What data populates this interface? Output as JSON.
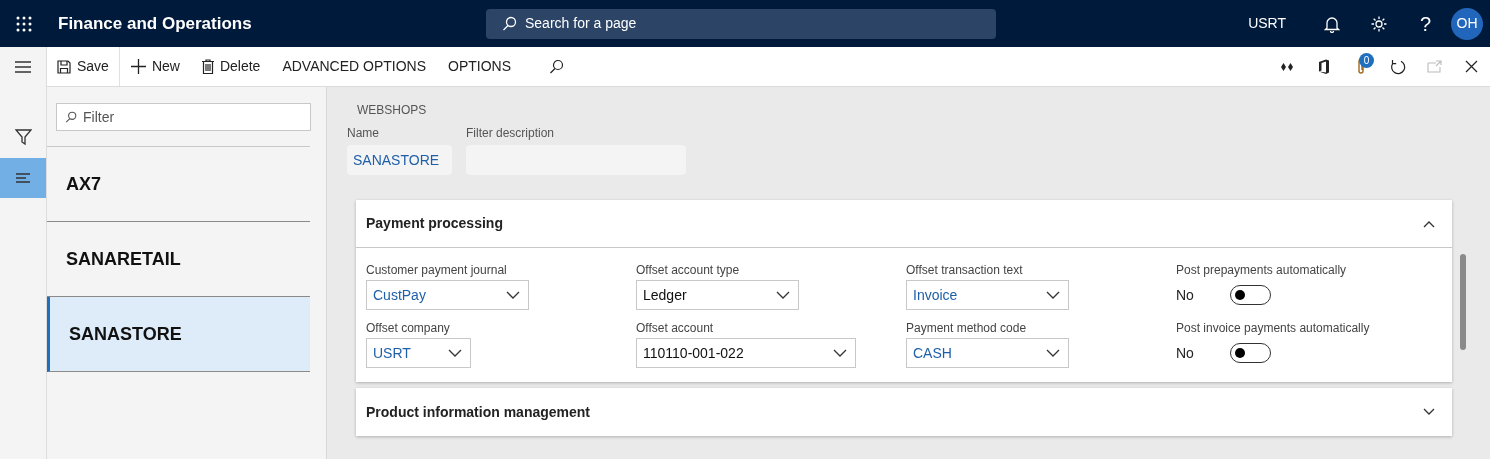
{
  "app": {
    "title": "Finance and Operations",
    "search_placeholder": "Search for a page",
    "company": "USRT",
    "help_glyph": "?",
    "avatar": "OH"
  },
  "action_bar": {
    "buttons": [
      {
        "kind": "save",
        "label": "Save"
      },
      {
        "kind": "new",
        "label": "New"
      },
      {
        "kind": "delete",
        "label": "Delete"
      },
      {
        "kind": "text",
        "label": "ADVANCED OPTIONS"
      },
      {
        "kind": "text",
        "label": "OPTIONS"
      },
      {
        "kind": "find"
      }
    ],
    "attachments_count": "0"
  },
  "nav": [
    {
      "kind": "menu",
      "selected": false
    },
    {
      "kind": "filter",
      "selected": false
    },
    {
      "kind": "list",
      "selected": true
    }
  ],
  "list": {
    "filter_placeholder": "Filter",
    "items": [
      {
        "label": "AX7",
        "selected": false
      },
      {
        "label": "SANARETAIL",
        "selected": false
      },
      {
        "label": "SANASTORE",
        "selected": true
      }
    ]
  },
  "header": {
    "caption": "WEBSHOPS",
    "fields": [
      {
        "label": "Name",
        "value": "SANASTORE"
      },
      {
        "label": "Filter description"
      }
    ]
  },
  "sections": [
    {
      "title": "Payment processing",
      "expanded": true,
      "columns": [
        [
          {
            "kind": "lookup",
            "label": "Customer payment journal",
            "value": "CustPay"
          },
          {
            "kind": "lookup",
            "label": "Offset company",
            "value": "USRT"
          }
        ],
        [
          {
            "kind": "enum",
            "label": "Offset account type",
            "value": "Ledger"
          },
          {
            "kind": "enum",
            "label": "Offset account",
            "value": "110110-001-022"
          }
        ],
        [
          {
            "kind": "lookup",
            "label": "Offset transaction text",
            "value": "Invoice"
          },
          {
            "kind": "lookup",
            "label": "Payment method code",
            "value": "CASH"
          }
        ],
        [
          {
            "kind": "toggle",
            "label": "Post prepayments automatically",
            "value": "No",
            "on": false
          },
          {
            "kind": "toggle",
            "label": "Post invoice payments automatically",
            "value": "No",
            "on": false
          }
        ]
      ]
    },
    {
      "title": "Product information management",
      "expanded": false
    }
  ]
}
